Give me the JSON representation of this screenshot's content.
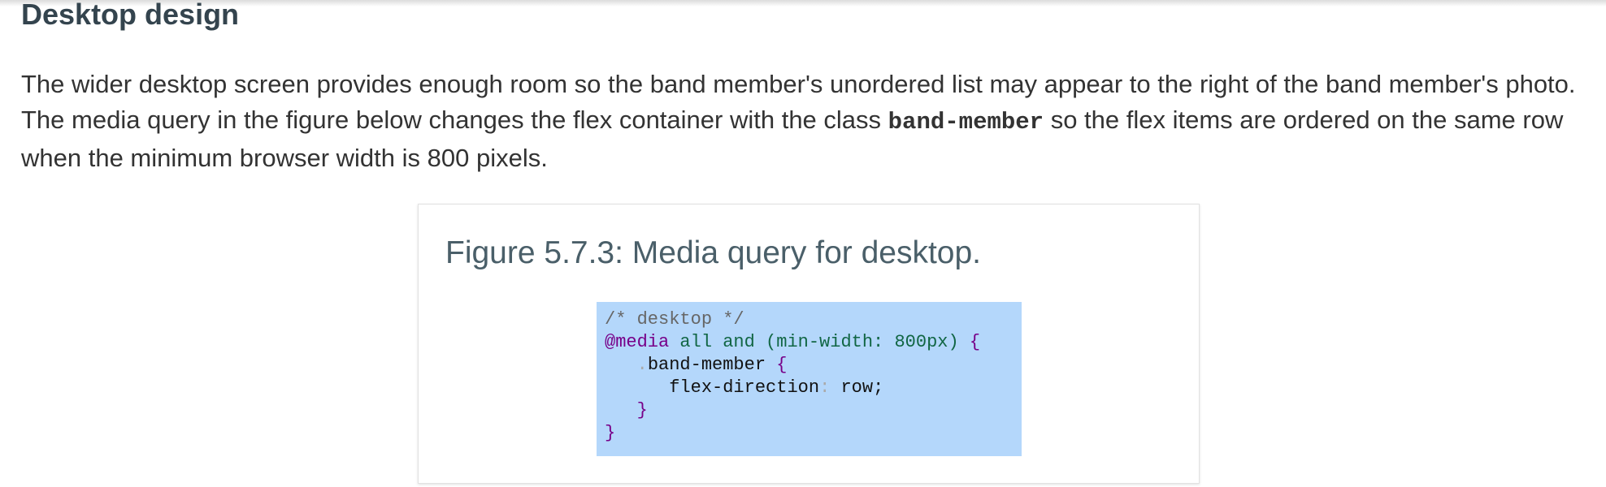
{
  "section": {
    "heading": "Desktop design"
  },
  "intro": {
    "text_part1": "The wider desktop screen provides enough room so the band member's unordered list may appear to the right of the band member's photo. The media query in the figure below changes the flex container with the class ",
    "code_term": "band-member",
    "text_part2": " so the flex items are ordered on the same row when the minimum browser width is 800 pixels."
  },
  "figure": {
    "caption": "Figure 5.7.3: Media query for desktop.",
    "code": {
      "comment": "/* desktop */",
      "at_rule": "@media",
      "query": " all and (min-width: 800px) ",
      "open_brace": "{",
      "indent_selector": "   ",
      "selector_dot": ".",
      "selector_name": "band-member ",
      "selector_open_brace": "{",
      "indent_prop": "      ",
      "property": "flex-direction",
      "colon": ":",
      "value": " row;",
      "indent_close_inner": "   ",
      "close_inner_brace": "}",
      "close_outer_brace": "}"
    },
    "code_highlight_color": "#b4d7fb"
  },
  "colors": {
    "heading": "#34444e",
    "caption": "#4a5f69",
    "body_text": "#333333"
  }
}
